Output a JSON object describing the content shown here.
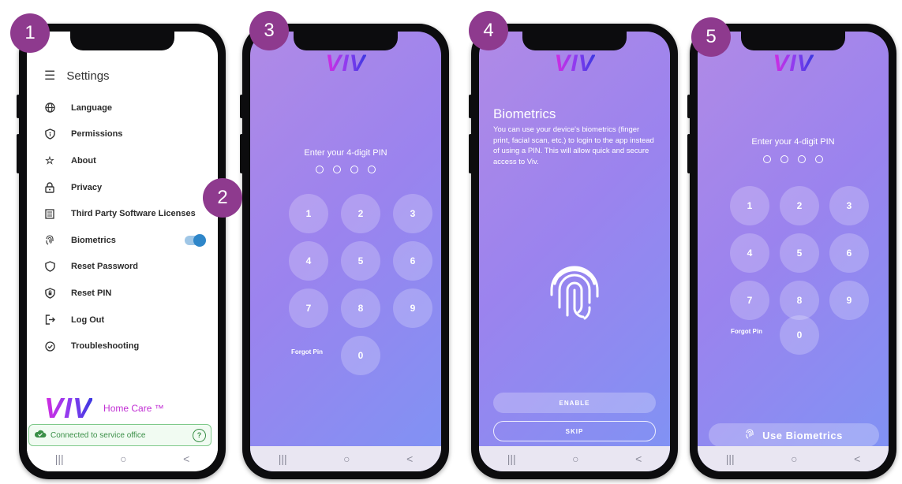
{
  "badges": [
    "1",
    "2",
    "3",
    "4",
    "5"
  ],
  "settings": {
    "title": "Settings",
    "items": [
      {
        "label": "Language",
        "icon": "globe-icon"
      },
      {
        "label": "Permissions",
        "icon": "shield-icon"
      },
      {
        "label": "About",
        "icon": "star-icon"
      },
      {
        "label": "Privacy",
        "icon": "lock-icon"
      },
      {
        "label": "Third Party Software Licenses",
        "icon": "document-icon"
      },
      {
        "label": "Biometrics",
        "icon": "fingerprint-icon",
        "toggle": true
      },
      {
        "label": "Reset Password",
        "icon": "shield-outline-icon"
      },
      {
        "label": "Reset PIN",
        "icon": "shield-lock-icon"
      },
      {
        "label": "Log Out",
        "icon": "logout-icon"
      },
      {
        "label": "Troubleshooting",
        "icon": "check-circle-icon"
      }
    ],
    "brand": {
      "logo": "VIV",
      "tagline": "Home Care ™"
    },
    "connection": {
      "text": "Connected to service office",
      "help": "?"
    }
  },
  "pin": {
    "logo": "VIV",
    "title": "Enter your 4-digit PIN",
    "keys": [
      "1",
      "2",
      "3",
      "4",
      "5",
      "6",
      "7",
      "8",
      "9",
      "0"
    ],
    "forgot": "Forgot Pin"
  },
  "biometrics": {
    "logo": "VIV",
    "title": "Biometrics",
    "description": "You can use your device's biometrics (finger print, facial scan, etc.) to login to the app instead of using a PIN. This will allow quick and secure access to Viv.",
    "enable": "ENABLE",
    "skip": "SKIP"
  },
  "pin2": {
    "logo": "VIV",
    "title": "Enter your 4-digit PIN",
    "forgot": "Forgot Pin",
    "use_biometrics": "Use Biometrics"
  },
  "navbar": {
    "recent": "|||",
    "home": "○",
    "back": "<"
  },
  "colors": {
    "badge": "#8e3a8e",
    "gradient_start": "#b08ae6",
    "gradient_end": "#7f93f4",
    "toggle": "#2e86c9"
  }
}
